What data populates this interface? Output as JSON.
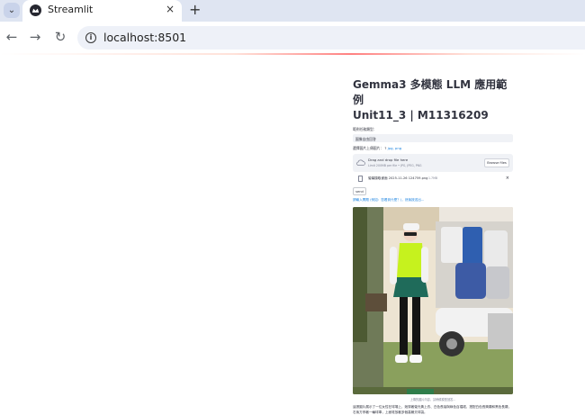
{
  "browser": {
    "tab_title": "Streamlit",
    "new_tab": "+",
    "close": "×",
    "menu": "⌄",
    "url": "localhost:8501",
    "nav": {
      "back": "←",
      "forward": "→",
      "reload": "↻"
    }
  },
  "app": {
    "title_line1": "Gemma3 多模態 LLM 應用範例",
    "title_line2": "Unit11_3 | M11316209",
    "mode_label": "範例任務類型：",
    "mode_value": "圖像自由回答",
    "upload_label": "選擇圖片上傳圖片：",
    "upload_help": "?",
    "upload_link": "jpg, png",
    "drag_text": "Drag and drop file here",
    "limit_text": "Limit 200MB per file • JPG, JPEG, PNG",
    "browse_label": "Browse files",
    "file_name": "螢幕擷取畫面 2025-11-26 124759.png",
    "file_size": "1.7MB",
    "file_remove": "×",
    "send_label": "send",
    "status_text": "請輸入問題 (例如：您看到什麼？)，然後按送出...",
    "caption": "上傳的圖片內容，請稍候模型回答...",
    "answer": "這張圖片展示了一位女性在球場上，她穿著螢光黃上衣、白色長袖與綠色百褶裙，搭配白色長筒襪和黑色長襪，右後方停著一輛球車，上面堆放著多個高爾夫球袋。"
  }
}
